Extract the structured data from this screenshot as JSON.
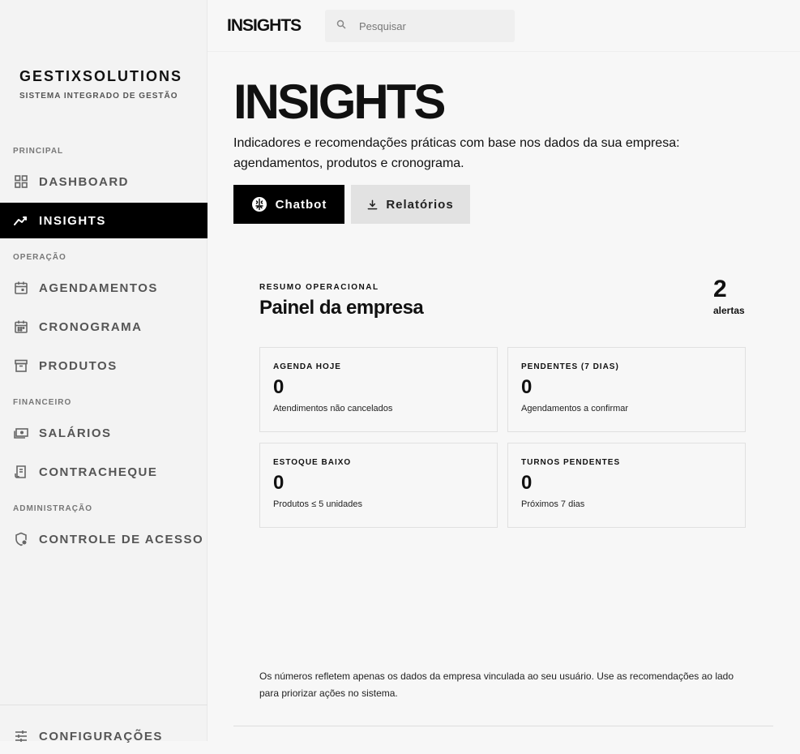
{
  "brand": {
    "name": "GESTIXSOLUTIONS",
    "subtitle": "SISTEMA INTEGRADO DE GESTÃO"
  },
  "sidebar": {
    "sections": [
      {
        "label": "PRINCIPAL"
      },
      {
        "label": "OPERAÇÃO"
      },
      {
        "label": "FINANCEIRO"
      },
      {
        "label": "ADMINISTRAÇÃO"
      }
    ],
    "items": [
      {
        "label": "DASHBOARD",
        "icon": "grid-icon"
      },
      {
        "label": "INSIGHTS",
        "icon": "trending-icon",
        "active": true
      },
      {
        "label": "AGENDAMENTOS",
        "icon": "calendar-check-icon"
      },
      {
        "label": "CRONOGRAMA",
        "icon": "calendar-icon"
      },
      {
        "label": "PRODUTOS",
        "icon": "archive-icon"
      },
      {
        "label": "SALÁRIOS",
        "icon": "money-icon"
      },
      {
        "label": "CONTRACHEQUE",
        "icon": "receipt-icon"
      },
      {
        "label": "CONTROLE DE ACESSO",
        "icon": "shield-lock-icon"
      }
    ],
    "footer": {
      "label": "CONFIGURAÇÕES",
      "icon": "sliders-icon"
    }
  },
  "topbar": {
    "title": "INSIGHTS",
    "search_placeholder": "Pesquisar"
  },
  "page": {
    "title": "INSIGHTS",
    "description": "Indicadores e recomendações práticas com base nos dados da sua empresa: agendamentos, produtos e cronograma.",
    "buttons": {
      "chatbot": "Chatbot",
      "reports": "Relatórios"
    }
  },
  "panel": {
    "kicker": "RESUMO OPERACIONAL",
    "title": "Painel da empresa",
    "alerts_count": "2",
    "alerts_label": "alertas",
    "cards": [
      {
        "label": "AGENDA HOJE",
        "value": "0",
        "sub": "Atendimentos não cancelados"
      },
      {
        "label": "PENDENTES (7 DIAS)",
        "value": "0",
        "sub": "Agendamentos a confirmar"
      },
      {
        "label": "ESTOQUE BAIXO",
        "value": "0",
        "sub": "Produtos ≤ 5 unidades"
      },
      {
        "label": "TURNOS PENDENTES",
        "value": "0",
        "sub": "Próximos 7 dias"
      }
    ]
  },
  "footnote": "Os números refletem apenas os dados da empresa vinculada ao seu usuário. Use as recomendações ao lado para priorizar ações no sistema."
}
